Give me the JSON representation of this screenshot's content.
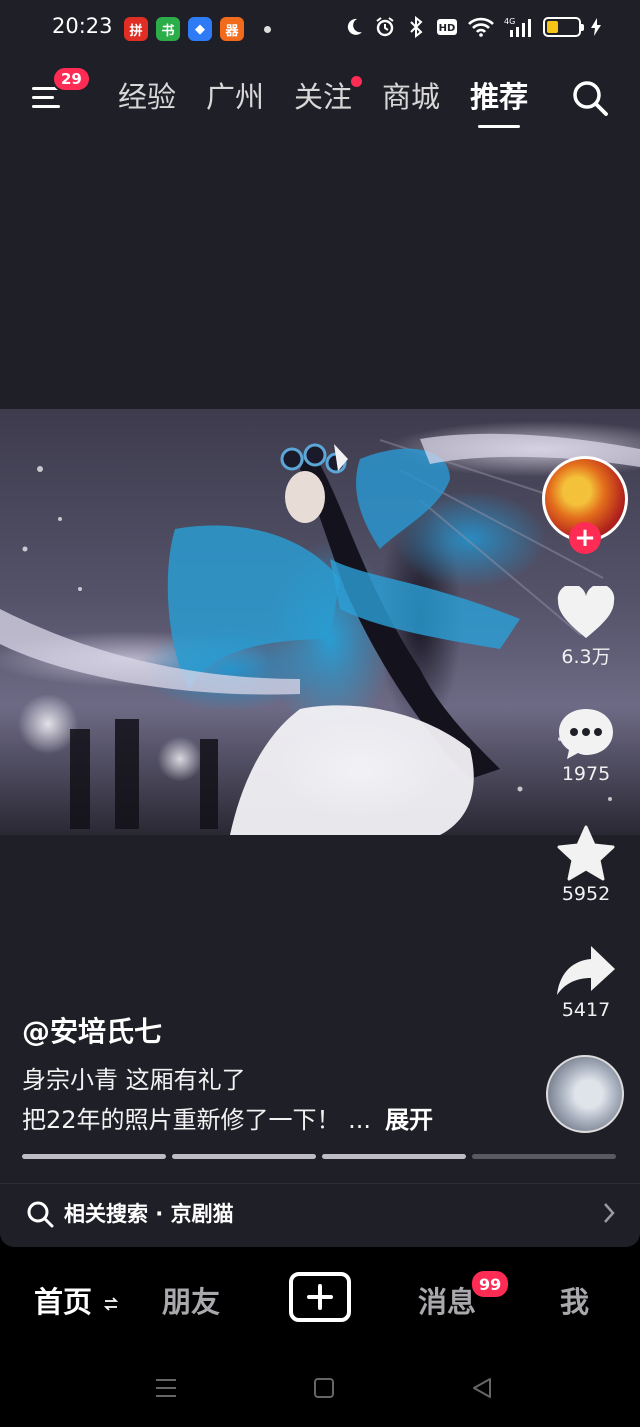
{
  "status_bar": {
    "time": "20:23",
    "apps": [
      {
        "icon": "pinduoduo-app-icon",
        "glyph": "拼",
        "color": "#e02e24"
      },
      {
        "icon": "wechat-green-app-icon",
        "glyph": "书",
        "color": "#2bae4a"
      },
      {
        "icon": "blue-app-icon",
        "glyph": "◆",
        "color": "#2f7bf5"
      },
      {
        "icon": "orange-app-icon",
        "glyph": "器",
        "color": "#f26b1d"
      }
    ],
    "signal_label": "4G",
    "hd_label": "HD",
    "battery_level": 0.35
  },
  "top_nav": {
    "menu_badge": "29",
    "tabs": [
      {
        "label": "经验",
        "active": false,
        "dot": false
      },
      {
        "label": "广州",
        "active": false,
        "dot": false
      },
      {
        "label": "关注",
        "active": false,
        "dot": true
      },
      {
        "label": "商城",
        "active": false,
        "dot": false
      },
      {
        "label": "推荐",
        "active": true,
        "dot": false
      }
    ]
  },
  "actions": {
    "likes": "6.3万",
    "comments": "1975",
    "favorites": "5952",
    "shares": "5417"
  },
  "caption": {
    "author": "@安培氏七",
    "line1": "身宗小青 这厢有礼了",
    "line2": "把22年的照片重新修了一下！ ...",
    "expand": "展开"
  },
  "progress": {
    "segments": 4,
    "completed": 3
  },
  "related_search": {
    "text": "相关搜索 · 京剧猫"
  },
  "bottom_nav": {
    "home": "首页",
    "friends": "朋友",
    "messages": "消息",
    "messages_badge": "99",
    "me": "我"
  },
  "colors": {
    "accent": "#fe2c55",
    "background": "#1f1f27"
  }
}
